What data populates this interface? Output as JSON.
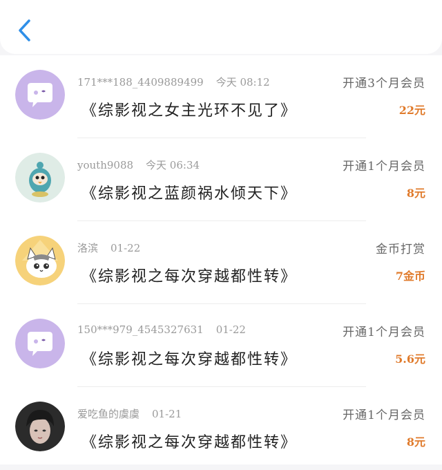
{
  "colors": {
    "accent_blue": "#2f8fe8",
    "amount_orange": "#e07b2c",
    "bubble_purple": "#c9b5ea"
  },
  "header": {
    "back_icon": "chevron-left-icon"
  },
  "records": [
    {
      "user": "171***188_4409889499",
      "time": "今天 08:12",
      "title": "《综影视之女主光环不见了》",
      "action": "开通3个月会员",
      "amount": "22元",
      "avatar": "chat-bubble-avatar"
    },
    {
      "user": "youth9088",
      "time": "今天 06:34",
      "title": "《综影视之蓝颜祸水倾天下》",
      "action": "开通1个月会员",
      "amount": "8元",
      "avatar": "cartoon-bird-avatar"
    },
    {
      "user": "洛滨",
      "time": "01-22",
      "title": "《综影视之每次穿越都性转》",
      "action": "金币打赏",
      "amount": "7金币",
      "avatar": "cartoon-cat-avatar"
    },
    {
      "user": "150***979_4545327631",
      "time": "01-22",
      "title": "《综影视之每次穿越都性转》",
      "action": "开通1个月会员",
      "amount": "5.6元",
      "avatar": "chat-bubble-avatar"
    },
    {
      "user": "爱吃鱼的虞虞",
      "time": "01-21",
      "title": "《综影视之每次穿越都性转》",
      "action": "开通1个月会员",
      "amount": "8元",
      "avatar": "photo-avatar"
    }
  ]
}
